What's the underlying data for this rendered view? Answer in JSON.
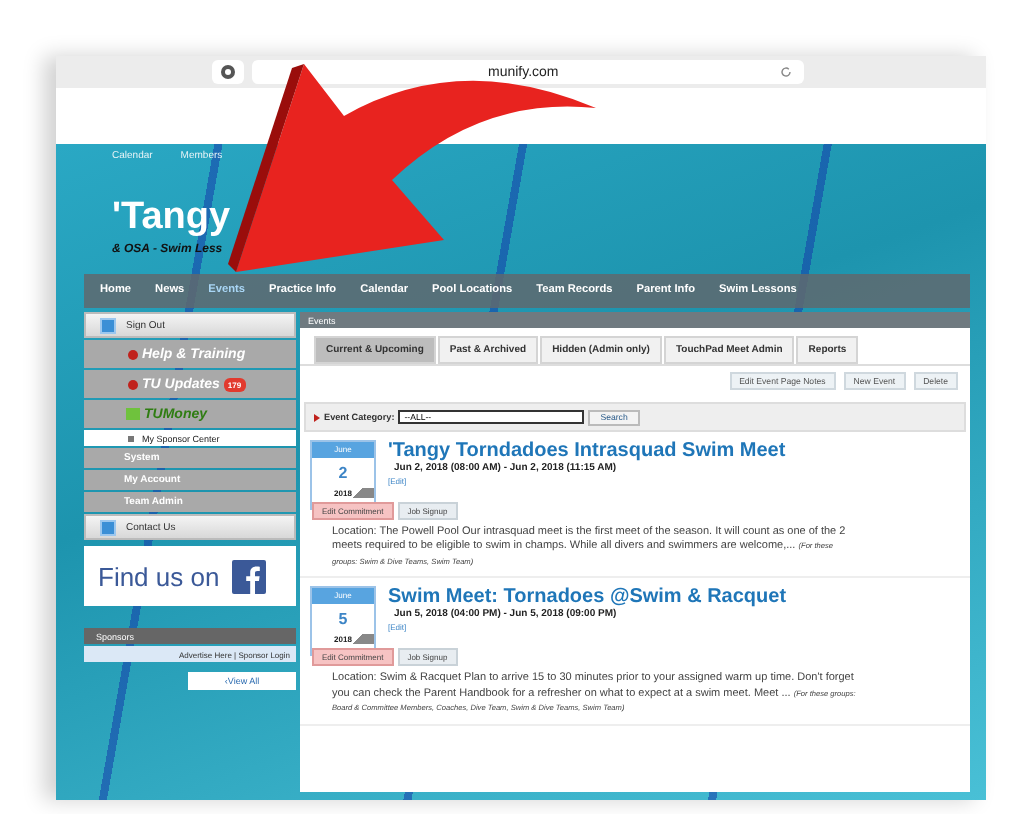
{
  "browser": {
    "url": "munify.com"
  },
  "top_links": [
    "Calendar",
    "Members"
  ],
  "site": {
    "title": "'Tangy",
    "subtitle": "& OSA - Swim Less"
  },
  "nav": [
    {
      "label": "Home",
      "selected": false
    },
    {
      "label": "News",
      "selected": false
    },
    {
      "label": "Events",
      "selected": true
    },
    {
      "label": "Practice Info",
      "selected": false
    },
    {
      "label": "Calendar",
      "selected": false
    },
    {
      "label": "Pool Locations",
      "selected": false
    },
    {
      "label": "Team Records",
      "selected": false
    },
    {
      "label": "Parent Info",
      "selected": false
    },
    {
      "label": "Swim Lessons",
      "selected": false
    }
  ],
  "sidebar": {
    "items": [
      {
        "kind": "button",
        "label": "Sign Out"
      },
      {
        "kind": "banner",
        "label": "Help & Training"
      },
      {
        "kind": "banner",
        "label": "TU Updates",
        "badge": "179"
      },
      {
        "kind": "money",
        "label": "TUMoney"
      },
      {
        "kind": "sub",
        "label": "My Sponsor Center"
      },
      {
        "kind": "section",
        "label": "System"
      },
      {
        "kind": "section",
        "label": "My Account"
      },
      {
        "kind": "section",
        "label": "Team Admin"
      },
      {
        "kind": "button",
        "label": "Contact Us"
      }
    ],
    "facebook": "Find us on",
    "sponsors": {
      "title": "Sponsors",
      "links": "Advertise Here | Sponsor Login",
      "view_all": "‹View All"
    }
  },
  "events": {
    "title": "Events",
    "tabs": [
      {
        "label": "Current & Upcoming",
        "selected": true
      },
      {
        "label": "Past & Archived",
        "selected": false
      },
      {
        "label": "Hidden (Admin only)",
        "selected": false
      },
      {
        "label": "TouchPad Meet Admin",
        "selected": false
      },
      {
        "label": "Reports",
        "selected": false
      }
    ],
    "actions": [
      "Edit Event Page Notes",
      "New Event",
      "Delete"
    ],
    "filter": {
      "label": "Event Category:",
      "value": "--ALL--",
      "button": "Search"
    },
    "items": [
      {
        "month": "June",
        "day": "2",
        "year": "2018",
        "title": "'Tangy Torndadoes Intrasquad Swim Meet",
        "time": "Jun 2, 2018 (08:00 AM) - Jun 2, 2018 (11:15 AM)",
        "edit": "[Edit]",
        "buttons": [
          "Edit Commitment",
          "Job Signup"
        ],
        "description": "Location: The Powell Pool Our intrasquad meet is the first meet of the season. It will count as one of the 2 meets required to be eligible to swim in champs. While all divers and swimmers are welcome,...",
        "groups": "(For these groups: Swim & Dive Teams, Swim Team)"
      },
      {
        "month": "June",
        "day": "5",
        "year": "2018",
        "title": "Swim Meet: Tornadoes @Swim & Racquet",
        "time": "Jun 5, 2018 (04:00 PM) - Jun 5, 2018 (09:00 PM)",
        "edit": "[Edit]",
        "buttons": [
          "Edit Commitment",
          "Job Signup"
        ],
        "description": "Location: Swim & Racquet Plan to arrive 15 to 30 minutes prior to your assigned warm up time. Don't forget you can check the Parent Handbook for a refresher on what to expect at a swim meet. Meet ...",
        "groups": "(For these groups: Board & Committee Members, Coaches, Dive Team, Swim & Dive Teams, Swim Team)"
      }
    ]
  }
}
